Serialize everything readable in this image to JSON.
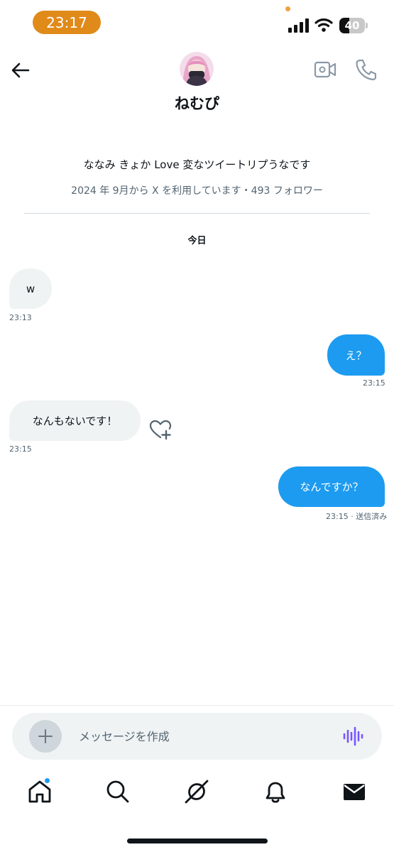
{
  "status_bar": {
    "time": "23:17",
    "battery": "40",
    "battery_level": 0.4
  },
  "header": {
    "name": "ねむぴ"
  },
  "profile": {
    "bio": "ななみ きょか Love 変なツイートリプうなです",
    "meta": "2024 年 9月から X を利用しています・493 フォロワー"
  },
  "conversation": {
    "date_label": "今日",
    "messages": [
      {
        "direction": "incoming",
        "text": "w",
        "time": "23:13"
      },
      {
        "direction": "outgoing",
        "text": "え？",
        "time": "23:15"
      },
      {
        "direction": "incoming",
        "text": "なんもないです！",
        "time": "23:15"
      },
      {
        "direction": "outgoing",
        "text": "なんですか？",
        "time": "23:15 · 送信済み"
      }
    ]
  },
  "composer": {
    "placeholder": "メッセージを作成"
  },
  "colors": {
    "accent": "#1d9bf0",
    "incoming_bubble": "#eff3f4",
    "status_time_pill": "#e08a1a",
    "voice_icon": "#7856ff"
  },
  "tabs": [
    {
      "icon": "home-icon",
      "active": true,
      "notification_dot": true
    },
    {
      "icon": "search-icon"
    },
    {
      "icon": "grok-icon"
    },
    {
      "icon": "bell-icon"
    },
    {
      "icon": "envelope-icon"
    }
  ]
}
